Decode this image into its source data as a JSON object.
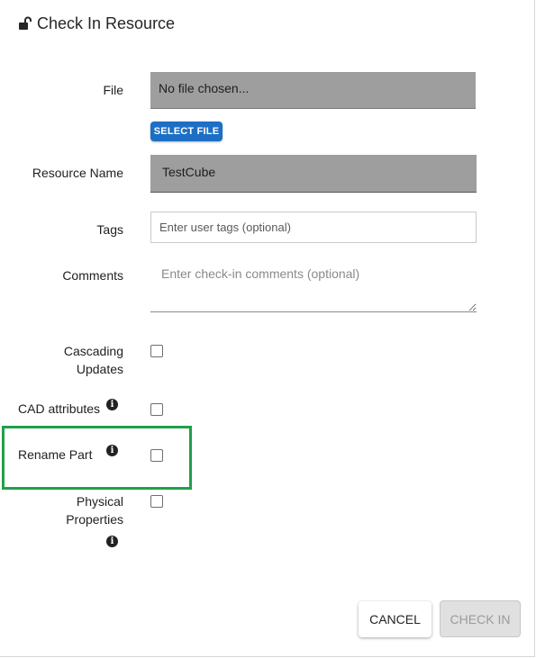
{
  "dialog": {
    "title": "Check In Resource",
    "title_icon": "unlock-icon"
  },
  "fields": {
    "file_label": "File",
    "file_value": "No file chosen...",
    "select_file_label": "SELECT FILE",
    "resource_name_label": "Resource Name",
    "resource_name_value": "TestCube",
    "tags_label": "Tags",
    "tags_placeholder": "Enter user tags (optional)",
    "comments_label": "Comments",
    "comments_placeholder": "Enter check-in comments (optional)"
  },
  "options": {
    "cascading_updates_line1": "Cascading",
    "cascading_updates_line2": "Updates",
    "cad_attributes": "CAD attributes",
    "rename_part": "Rename Part",
    "physical_properties_line1": "Physical",
    "physical_properties_line2": "Properties",
    "info_icon": "info-icon"
  },
  "actions": {
    "cancel_label": "CANCEL",
    "check_in_label": "CHECK IN"
  },
  "colors": {
    "primary": "#1c6fc5",
    "highlight": "#21a04a",
    "field_fill": "#9e9e9e"
  }
}
